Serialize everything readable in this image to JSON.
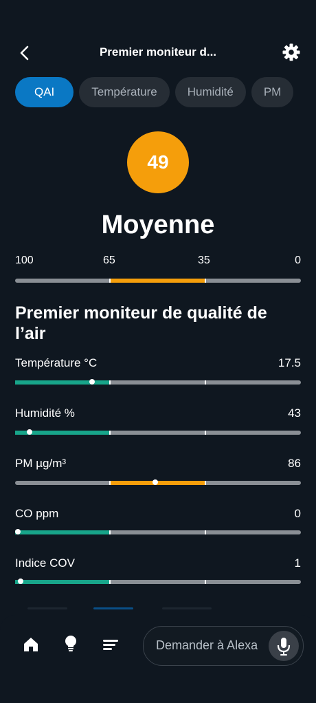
{
  "header": {
    "title": "Premier moniteur d...",
    "back_icon": "chevron-left-icon",
    "settings_icon": "gear-icon"
  },
  "tabs": [
    {
      "label": "QAI",
      "active": true
    },
    {
      "label": "Température",
      "active": false
    },
    {
      "label": "Humidité",
      "active": false
    },
    {
      "label": "PM",
      "active": false
    }
  ],
  "aqi": {
    "value": "49",
    "status": "Moyenne",
    "color": "#f59e0b",
    "scale_labels": [
      "100",
      "65",
      "35",
      "0"
    ]
  },
  "section_title": "Premier moniteur de qualité de l’air",
  "metrics": [
    {
      "label": "Température °C",
      "value": "17.5",
      "level_fraction": 0.27
    },
    {
      "label": "Humidité %",
      "value": "43",
      "level_fraction": 0.05
    },
    {
      "label": "PM µg/m³",
      "value": "86",
      "level_fraction": 0.49
    },
    {
      "label": "CO ppm",
      "value": "0",
      "level_fraction": 0.0
    },
    {
      "label": "Indice COV",
      "value": "1",
      "level_fraction": 0.02
    }
  ],
  "colors": {
    "good": "#18a58a",
    "moderate": "#f59e0b",
    "neutral": "#8a8f95",
    "accent": "#0a78c4"
  },
  "bottom_nav": {
    "items": [
      {
        "name": "home",
        "icon": "home-icon"
      },
      {
        "name": "devices",
        "icon": "lightbulb-icon"
      },
      {
        "name": "more",
        "icon": "menu-icon"
      }
    ],
    "alexa_placeholder": "Demander à Alexa",
    "mic_icon": "microphone-icon"
  }
}
